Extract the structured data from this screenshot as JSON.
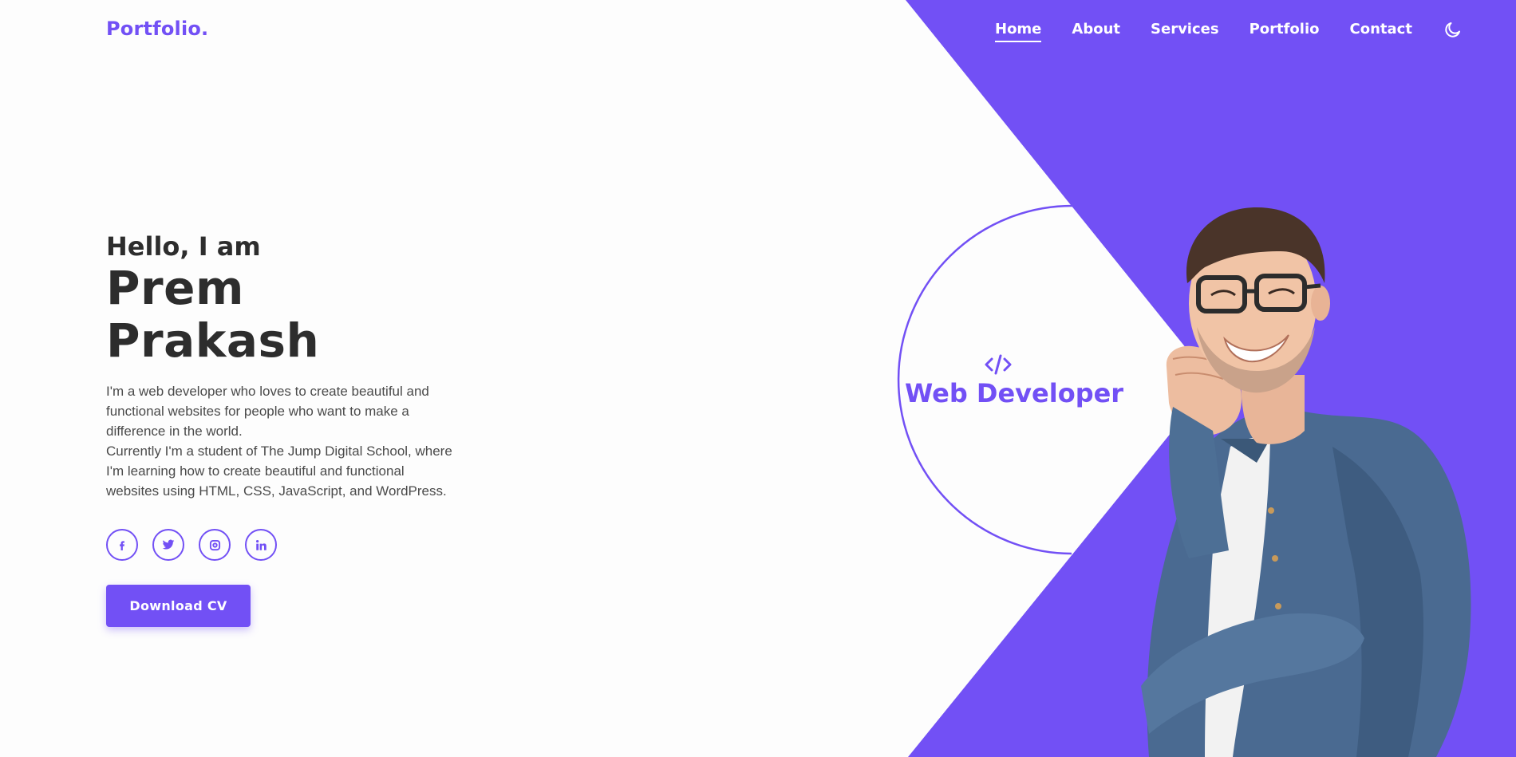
{
  "header": {
    "logo": "Portfolio.",
    "nav": [
      {
        "label": "Home",
        "active": true
      },
      {
        "label": "About",
        "active": false
      },
      {
        "label": "Services",
        "active": false
      },
      {
        "label": "Portfolio",
        "active": false
      },
      {
        "label": "Contact",
        "active": false
      }
    ],
    "theme_icon": "moon-icon"
  },
  "hero": {
    "greeting": "Hello, I am",
    "name": "Prem Prakash",
    "bio_1": "I'm a web developer who loves to create beautiful and functional websites for people who want to make a difference in the world.",
    "bio_2": "Currently I'm a student of The Jump Digital School, where I'm learning how to create beautiful and functional websites using HTML, CSS, JavaScript, and WordPress.",
    "socials": [
      "facebook-icon",
      "twitter-icon",
      "instagram-icon",
      "linkedin-icon"
    ],
    "cta_label": "Download CV"
  },
  "badge": {
    "icon": "code-icon",
    "label": "Web Developer"
  },
  "colors": {
    "accent": "#7250f5",
    "text_dark": "#2d2d2d",
    "background": "#fdfdfd"
  }
}
